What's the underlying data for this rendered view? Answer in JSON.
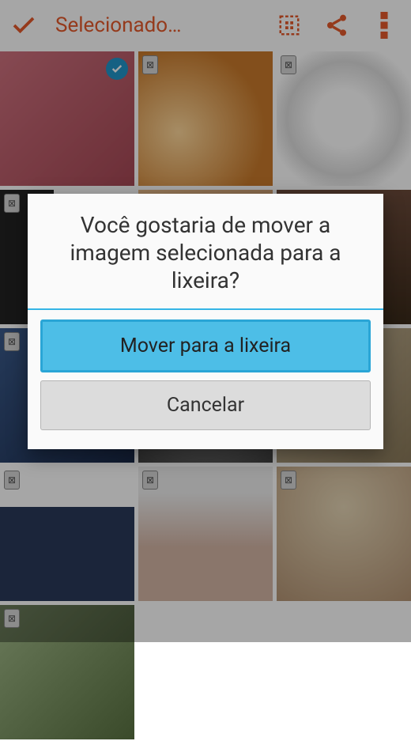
{
  "toolbar": {
    "title": "Selecionado…",
    "accent": "#e55a2b"
  },
  "dialog": {
    "title": "Você gostaria de mover a imagem selecionada para a lixeira?",
    "confirm_label": "Mover para a lixeira",
    "cancel_label": "Cancelar"
  },
  "grid": {
    "selected_index": 0,
    "items": [
      {
        "selected": true,
        "device_badge": false
      },
      {
        "selected": false,
        "device_badge": true
      },
      {
        "selected": false,
        "device_badge": true
      },
      {
        "selected": false,
        "device_badge": true
      },
      {
        "selected": false,
        "device_badge": true
      },
      {
        "selected": false,
        "device_badge": true
      },
      {
        "selected": false,
        "device_badge": true
      },
      {
        "selected": false,
        "device_badge": true
      },
      {
        "selected": false,
        "device_badge": true
      },
      {
        "selected": false,
        "device_badge": true
      },
      {
        "selected": false,
        "device_badge": true
      },
      {
        "selected": false,
        "device_badge": true
      },
      {
        "selected": false,
        "device_badge": true
      }
    ]
  },
  "icons": {
    "check": "check-icon",
    "select_all": "select-all-icon",
    "share": "share-icon",
    "overflow": "overflow-menu-icon"
  }
}
